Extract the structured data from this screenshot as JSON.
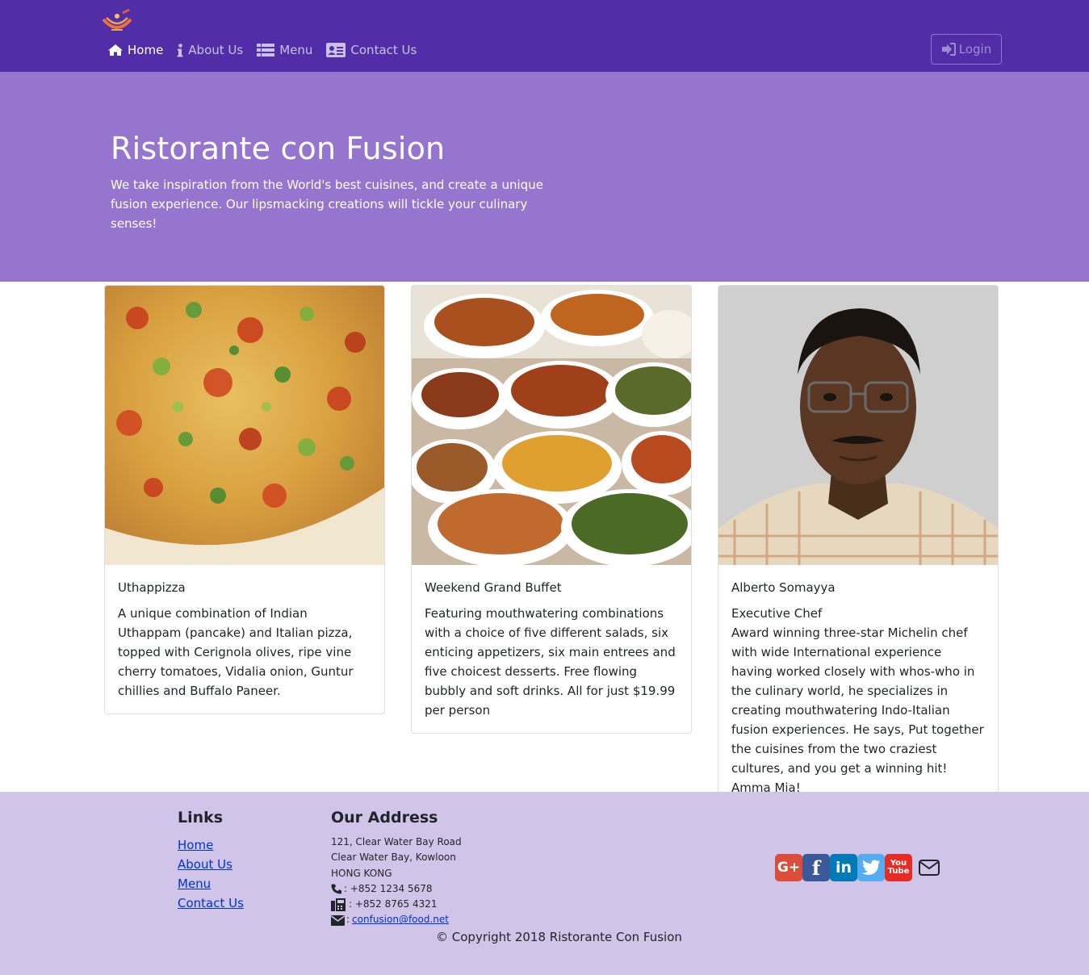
{
  "navbar": {
    "brand_logo": "restaurant-logo",
    "items": [
      {
        "label": "Home",
        "icon": "home-icon",
        "active": true
      },
      {
        "label": "About Us",
        "icon": "info-icon",
        "active": false
      },
      {
        "label": "Menu",
        "icon": "list-icon",
        "active": false
      },
      {
        "label": "Contact Us",
        "icon": "address-card-icon",
        "active": false
      }
    ],
    "login_label": "Login",
    "colors": {
      "primary": "#512DA8",
      "jumbotron": "#9575CD",
      "footer": "#D1C4E9"
    }
  },
  "jumbotron": {
    "title": "Ristorante con Fusion",
    "text": "We take inspiration from the World's best cuisines, and create a unique fusion experience. Our lipsmacking creations will tickle your culinary senses!"
  },
  "cards": [
    {
      "image": "uthappizza-photo",
      "title": "Uthappizza",
      "subtitle": "",
      "text": "A unique combination of Indian Uthappam (pancake) and Italian pizza, topped with Cerignola olives, ripe vine cherry tomatoes, Vidalia onion, Guntur chillies and Buffalo Paneer."
    },
    {
      "image": "buffet-photo",
      "title": "Weekend Grand Buffet",
      "subtitle": "",
      "text": "Featuring mouthwatering combinations with a choice of five different salads, six enticing appetizers, six main entrees and five choicest desserts. Free flowing bubbly and soft drinks. All for just $19.99 per person"
    },
    {
      "image": "chef-photo",
      "title": "Alberto Somayya",
      "subtitle": "Executive Chef",
      "text": "Award winning three-star Michelin chef with wide International experience having worked closely with whos-who in the culinary world, he specializes in creating mouthwatering Indo-Italian fusion experiences. He says, Put together the cuisines from the two craziest cultures, and you get a winning hit! Amma Mia!"
    }
  ],
  "footer": {
    "links_heading": "Links",
    "links": [
      "Home",
      "About Us",
      "Menu",
      "Contact Us"
    ],
    "address_heading": "Our Address",
    "address_lines": [
      "121, Clear Water Bay Road",
      "Clear Water Bay, Kowloon",
      "HONG KONG"
    ],
    "phone": ": +852 1234 5678",
    "fax": ": +852 8765 4321",
    "email_prefix": ":",
    "email": "confusion@food.net",
    "social": [
      {
        "name": "google-plus",
        "label": "G+",
        "color": "#DD4B39"
      },
      {
        "name": "facebook",
        "label": "f",
        "color": "#3B5998"
      },
      {
        "name": "linkedin",
        "label": "in",
        "color": "#007BB6"
      },
      {
        "name": "twitter",
        "label": "t",
        "color": "#55ACEE"
      },
      {
        "name": "youtube",
        "label": "You Tube",
        "color": "#E52D27"
      }
    ],
    "copyright": "© Copyright 2018 Ristorante Con Fusion"
  }
}
